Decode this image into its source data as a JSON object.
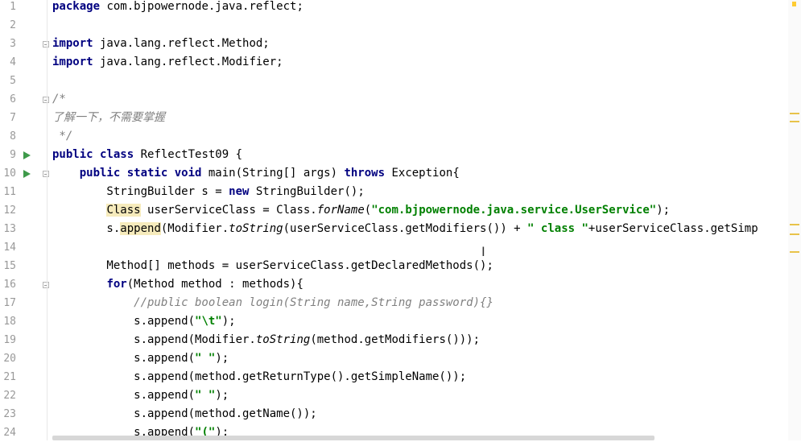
{
  "editor": {
    "colors": {
      "keyword": "#000080",
      "string": "#008000",
      "comment": "#808080",
      "run": "#3e9a4a",
      "highlight": "#f6ebbc"
    },
    "line_numbers": [
      "1",
      "2",
      "3",
      "4",
      "5",
      "6",
      "7",
      "8",
      "9",
      "10",
      "11",
      "12",
      "13",
      "14",
      "15",
      "16",
      "17",
      "18",
      "19",
      "20",
      "21",
      "22",
      "23",
      "24"
    ],
    "lines": [
      [
        {
          "t": "package",
          "c": "kw"
        },
        {
          "t": " com.bjpowernode.java.reflect;",
          "c": ""
        }
      ],
      [],
      [
        {
          "t": "import",
          "c": "kw"
        },
        {
          "t": " java.lang.reflect.Method;",
          "c": ""
        }
      ],
      [
        {
          "t": "import",
          "c": "kw"
        },
        {
          "t": " java.lang.reflect.Modifier;",
          "c": ""
        }
      ],
      [],
      [
        {
          "t": "/*",
          "c": "cmt"
        }
      ],
      [
        {
          "t": "了解一下，不需要掌握",
          "c": "cmt"
        }
      ],
      [
        {
          "t": " */",
          "c": "cmt"
        }
      ],
      [
        {
          "t": "public class",
          "c": "kw"
        },
        {
          "t": " ReflectTest09 {",
          "c": ""
        }
      ],
      [
        {
          "t": "    ",
          "c": ""
        },
        {
          "t": "public static void",
          "c": "kw"
        },
        {
          "t": " main(String[] args) ",
          "c": ""
        },
        {
          "t": "throws",
          "c": "kw"
        },
        {
          "t": " Exception{",
          "c": ""
        }
      ],
      [
        {
          "t": "        StringBuilder s = ",
          "c": ""
        },
        {
          "t": "new",
          "c": "kw"
        },
        {
          "t": " StringBuilder();",
          "c": ""
        }
      ],
      [
        {
          "t": "        ",
          "c": ""
        },
        {
          "t": "Class",
          "c": "hl"
        },
        {
          "t": " userServiceClass = Class.",
          "c": ""
        },
        {
          "t": "forName",
          "c": "it"
        },
        {
          "t": "(",
          "c": ""
        },
        {
          "t": "\"com.bjpowernode.java.service.UserService\"",
          "c": "str"
        },
        {
          "t": ");",
          "c": ""
        }
      ],
      [
        {
          "t": "        s.",
          "c": ""
        },
        {
          "t": "append",
          "c": "hl"
        },
        {
          "t": "(Modifier.",
          "c": ""
        },
        {
          "t": "toString",
          "c": "it"
        },
        {
          "t": "(userServiceClass.getModifiers()) + ",
          "c": ""
        },
        {
          "t": "\" class \"",
          "c": "str"
        },
        {
          "t": "+userServiceClass.getSimp",
          "c": ""
        }
      ],
      [],
      [
        {
          "t": "        Method[] methods = userServiceClass.getDeclaredMethods();",
          "c": ""
        }
      ],
      [
        {
          "t": "        ",
          "c": ""
        },
        {
          "t": "for",
          "c": "kw"
        },
        {
          "t": "(Method method : methods){",
          "c": ""
        }
      ],
      [
        {
          "t": "            //public boolean login(String name,String password){}",
          "c": "cmt"
        }
      ],
      [
        {
          "t": "            s.append(",
          "c": ""
        },
        {
          "t": "\"\\t\"",
          "c": "str"
        },
        {
          "t": ");",
          "c": ""
        }
      ],
      [
        {
          "t": "            s.append(Modifier.",
          "c": ""
        },
        {
          "t": "toString",
          "c": "it"
        },
        {
          "t": "(method.getModifiers()));",
          "c": ""
        }
      ],
      [
        {
          "t": "            s.append(",
          "c": ""
        },
        {
          "t": "\" \"",
          "c": "str"
        },
        {
          "t": ");",
          "c": ""
        }
      ],
      [
        {
          "t": "            s.append(method.getReturnType().getSimpleName());",
          "c": ""
        }
      ],
      [
        {
          "t": "            s.append(",
          "c": ""
        },
        {
          "t": "\" \"",
          "c": "str"
        },
        {
          "t": ");",
          "c": ""
        }
      ],
      [
        {
          "t": "            s.append(method.getName());",
          "c": ""
        }
      ],
      [
        {
          "t": "            s.append(",
          "c": ""
        },
        {
          "t": "\"(\"",
          "c": "str"
        },
        {
          "t": ");",
          "c": ""
        }
      ]
    ],
    "run_lines": [
      9,
      10
    ],
    "fold_lines": [
      3,
      6,
      10,
      16
    ]
  }
}
